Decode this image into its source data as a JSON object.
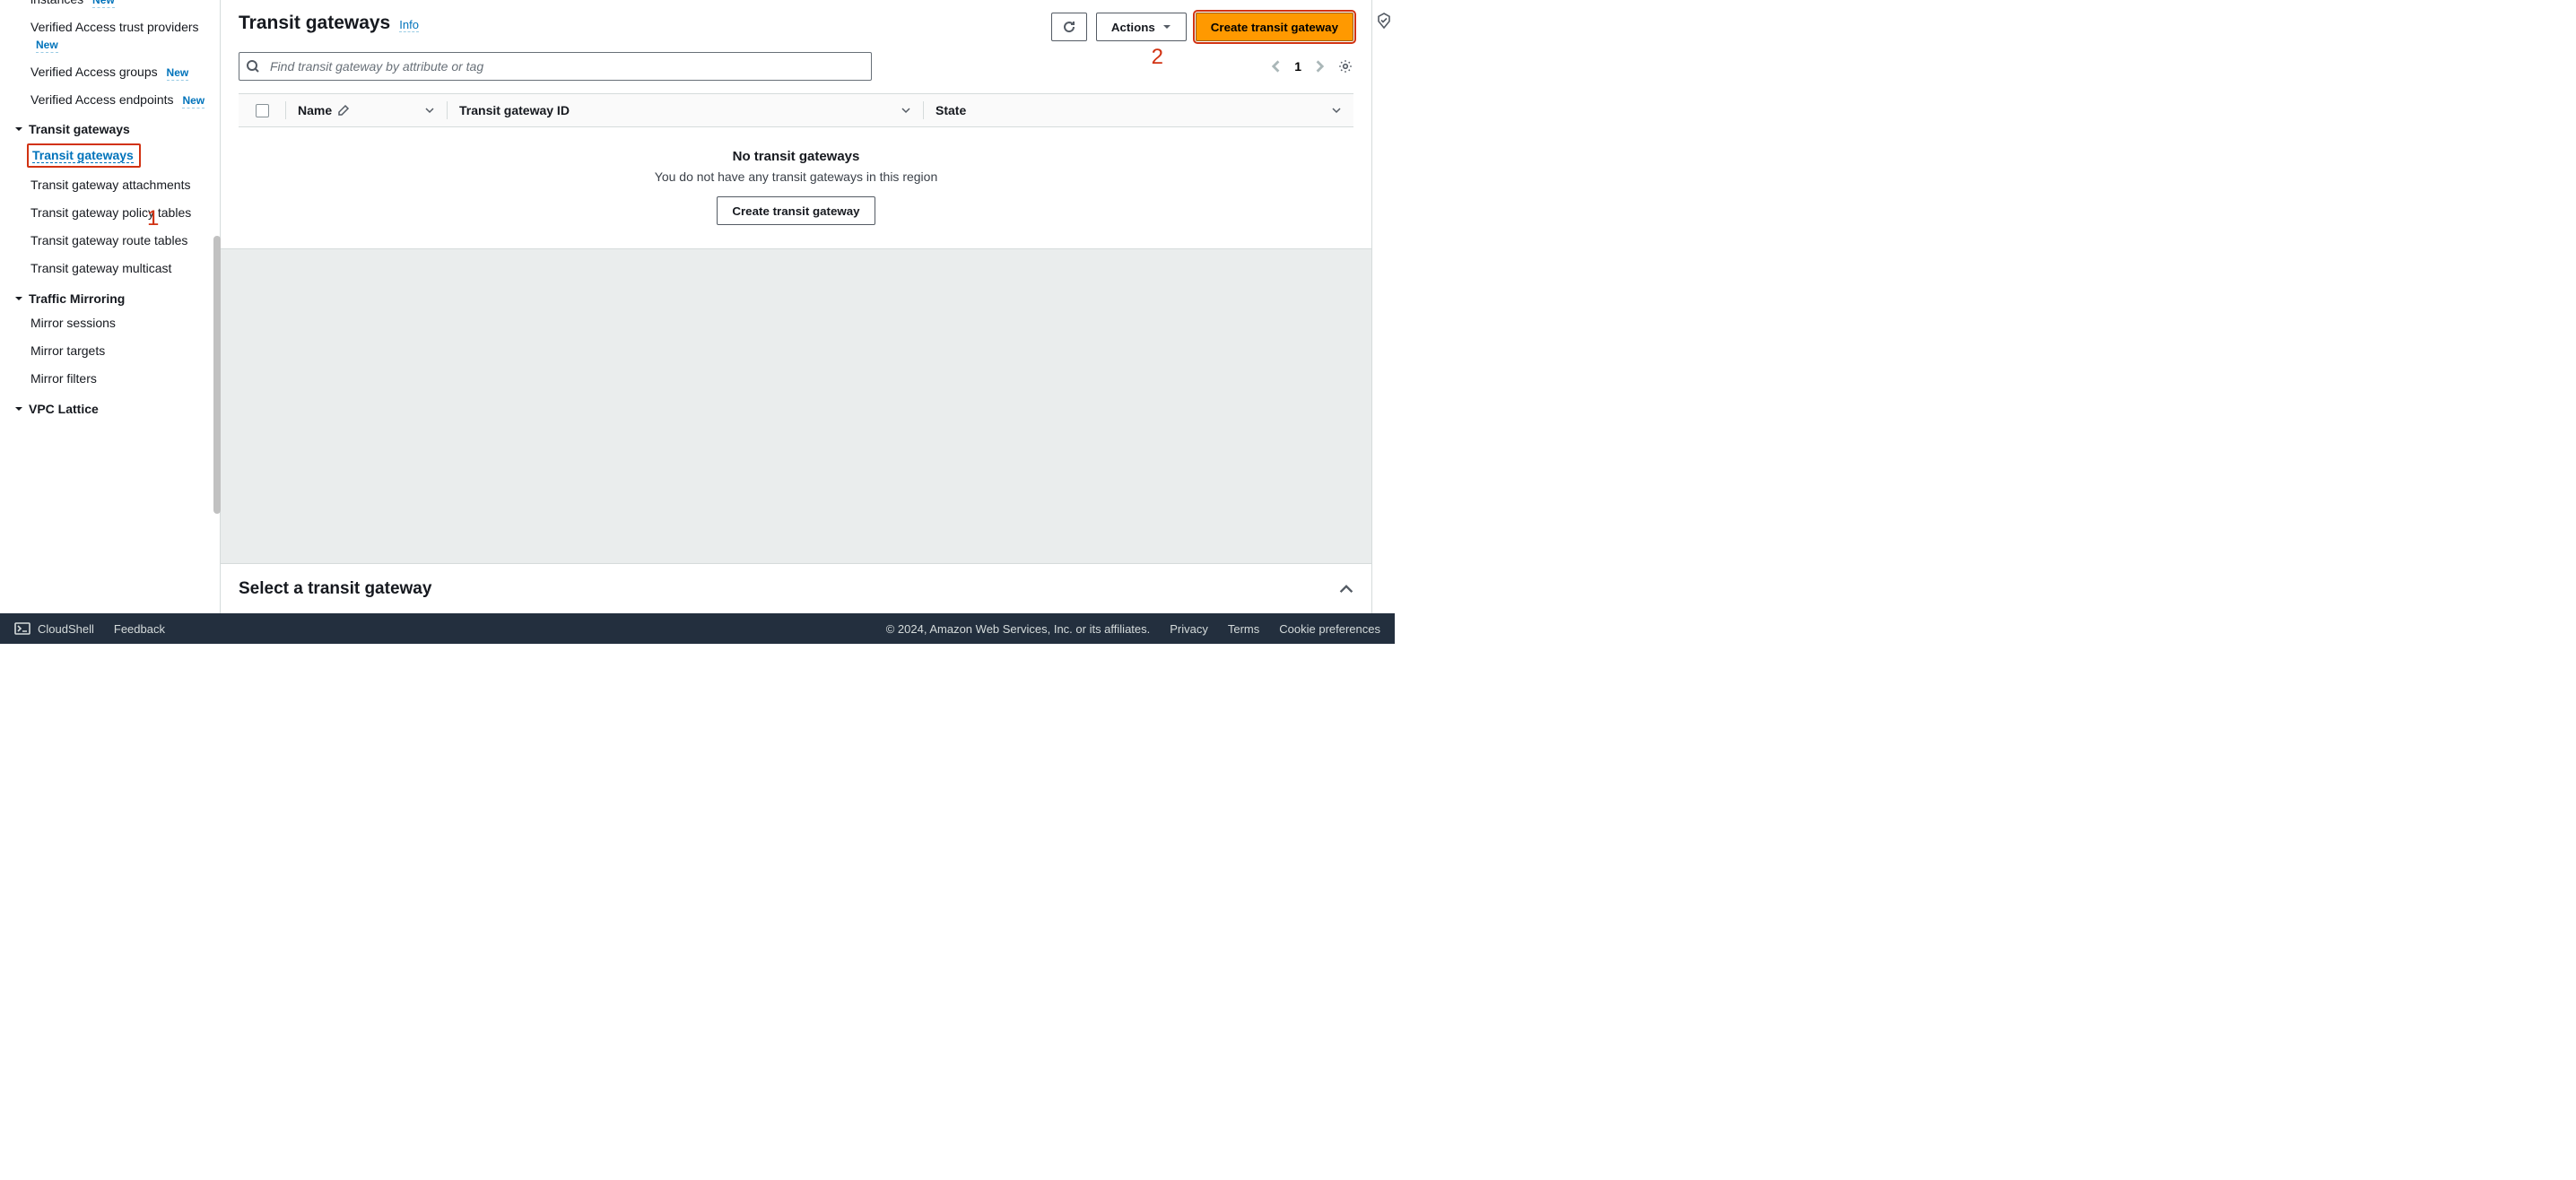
{
  "annotations": {
    "one": "1",
    "two": "2"
  },
  "sidebar": {
    "verified_access": {
      "instances": {
        "label": "instances",
        "badge": "New"
      },
      "trust_providers": {
        "label": "Verified Access trust providers",
        "badge": "New"
      },
      "groups": {
        "label": "Verified Access groups",
        "badge": "New"
      },
      "endpoints": {
        "label": "Verified Access endpoints",
        "badge": "New"
      }
    },
    "tg": {
      "section": "Transit gateways",
      "items": {
        "gateways": "Transit gateways",
        "attachments": "Transit gateway attachments",
        "policy_tables": "Transit gateway policy tables",
        "route_tables": "Transit gateway route tables",
        "multicast": "Transit gateway multicast"
      }
    },
    "mirroring": {
      "section": "Traffic Mirroring",
      "items": {
        "sessions": "Mirror sessions",
        "targets": "Mirror targets",
        "filters": "Mirror filters"
      }
    },
    "lattice": {
      "section": "VPC Lattice"
    }
  },
  "header": {
    "title": "Transit gateways",
    "info": "Info",
    "actions": {
      "refresh": "Refresh",
      "menu": "Actions",
      "create": "Create transit gateway"
    }
  },
  "search": {
    "placeholder": "Find transit gateway by attribute or tag",
    "value": ""
  },
  "pager": {
    "page": "1"
  },
  "table": {
    "cols": {
      "name": "Name",
      "tgid": "Transit gateway ID",
      "state": "State"
    }
  },
  "empty": {
    "title": "No transit gateways",
    "subtitle": "You do not have any transit gateways in this region",
    "cta": "Create transit gateway"
  },
  "bottom": {
    "title": "Select a transit gateway"
  },
  "footer": {
    "cloudshell": "CloudShell",
    "feedback": "Feedback",
    "copyright": "© 2024, Amazon Web Services, Inc. or its affiliates.",
    "privacy": "Privacy",
    "terms": "Terms",
    "cookies": "Cookie preferences"
  }
}
